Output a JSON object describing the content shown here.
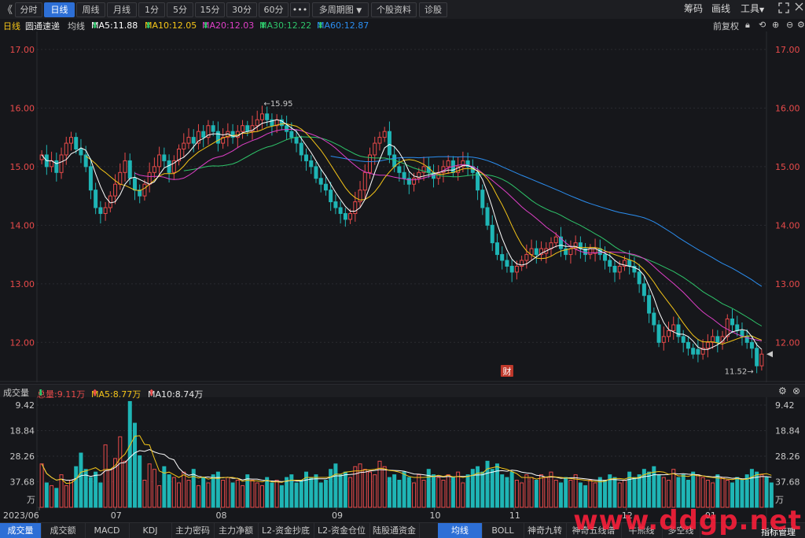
{
  "toolbar": {
    "collapse_icon": "《",
    "periods": [
      "分时",
      "日线",
      "周线",
      "月线",
      "1分",
      "5分",
      "15分",
      "30分",
      "60分"
    ],
    "active_period": "日线",
    "more_label": "•••",
    "multi_period_label": "多周期图",
    "stock_info_label": "个股资料",
    "diagnose_label": "诊股",
    "chips_label": "筹码",
    "draw_label": "画线",
    "tools_label": "工具",
    "expand_icon": "expand-icon",
    "close_icon": "close-icon"
  },
  "legend": {
    "period": "日线",
    "stock_name": "圆通速递",
    "ma_label": "均线",
    "ma5": "MA5:11.88",
    "ma10": "MA10:12.05",
    "ma20": "MA20:12.03",
    "ma30": "MA30:12.22",
    "ma60": "MA60:12.87",
    "adjust": "前复权",
    "colors": {
      "ma5": "#ffffff",
      "ma10": "#f5c518",
      "ma20": "#e040c8",
      "ma30": "#2ec46a",
      "ma60": "#2b8ef0"
    }
  },
  "volume_legend": {
    "label": "成交量",
    "total": "总量:9.11万",
    "ma5": "MA5:8.77万",
    "ma10": "MA10:8.74万"
  },
  "price_chart": {
    "y_ticks": [
      "17.00",
      "16.00",
      "15.00",
      "14.00",
      "13.00",
      "12.00"
    ],
    "high_annotation": "←15.95",
    "low_annotation": "11.52→",
    "fin_marker": "财"
  },
  "volume_chart": {
    "y_ticks": [
      "37.68",
      "28.26",
      "18.84",
      "9.42"
    ],
    "unit": "万"
  },
  "x_labels": [
    "2023/06",
    "07",
    "08",
    "09",
    "10",
    "11",
    "12",
    "01"
  ],
  "bottom_tabs": [
    "成交量",
    "成交额",
    "MACD",
    "KDJ",
    "主力密码",
    "主力净额",
    "L2-资金抄底",
    "L2-资金仓位",
    "陆股通资金",
    "均线",
    "BOLL",
    "神奇九转",
    "神奇五线谱",
    "牛熊线",
    "多空线"
  ],
  "active_left_tab": "成交量",
  "active_right_tab": "均线",
  "indicator_manage": "指标管理",
  "watermark": "www.ddgp.net",
  "chart_data": {
    "type": "candlestick",
    "title": "圆通速递 日线",
    "xlabel": "",
    "ylabel": "",
    "ylim": [
      11.4,
      17.2
    ],
    "closes": [
      15.2,
      15.0,
      15.1,
      14.9,
      15.2,
      15.4,
      15.5,
      15.3,
      15.2,
      15.0,
      14.6,
      14.3,
      14.2,
      14.3,
      14.5,
      14.7,
      14.9,
      15.1,
      14.8,
      14.6,
      14.5,
      14.7,
      14.9,
      15.0,
      15.2,
      15.1,
      14.9,
      15.1,
      15.3,
      15.4,
      15.5,
      15.4,
      15.6,
      15.5,
      15.7,
      15.6,
      15.4,
      15.5,
      15.6,
      15.5,
      15.6,
      15.7,
      15.6,
      15.7,
      15.8,
      15.9,
      15.8,
      15.7,
      15.8,
      15.7,
      15.6,
      15.5,
      15.4,
      15.2,
      15.1,
      15.0,
      14.8,
      14.7,
      14.6,
      14.4,
      14.3,
      14.2,
      14.1,
      14.2,
      14.4,
      14.6,
      14.9,
      15.2,
      15.4,
      15.5,
      15.6,
      15.2,
      15.0,
      14.9,
      14.8,
      14.7,
      14.8,
      14.9,
      15.0,
      14.9,
      14.8,
      14.9,
      15.0,
      15.1,
      14.9,
      15.0,
      15.1,
      15.0,
      14.9,
      14.6,
      14.3,
      14.0,
      13.7,
      13.5,
      13.4,
      13.3,
      13.2,
      13.3,
      13.4,
      13.5,
      13.6,
      13.5,
      13.6,
      13.6,
      13.7,
      13.8,
      13.6,
      13.5,
      13.6,
      13.7,
      13.6,
      13.5,
      13.6,
      13.6,
      13.5,
      13.4,
      13.3,
      13.2,
      13.3,
      13.4,
      13.3,
      13.2,
      13.0,
      12.8,
      12.5,
      12.3,
      12.0,
      12.1,
      12.2,
      12.3,
      12.1,
      12.0,
      11.9,
      11.8,
      11.8,
      11.9,
      12.0,
      12.1,
      12.0,
      12.1,
      12.4,
      12.3,
      12.2,
      12.1,
      12.0,
      11.9,
      11.6,
      11.8
    ],
    "volume_ylim": [
      0,
      40
    ],
    "volume_ticks": [
      9.42,
      18.84,
      28.26,
      37.68
    ],
    "volume_unit": "万",
    "volumes": [
      16,
      9,
      8,
      7,
      12,
      8,
      10,
      15,
      20,
      14,
      11,
      13,
      9,
      23,
      14,
      18,
      26,
      17,
      39,
      31,
      19,
      10,
      16,
      14,
      8,
      15,
      12,
      11,
      9,
      13,
      10,
      14,
      8,
      11,
      9,
      12,
      13,
      10,
      11,
      9,
      10,
      8,
      12,
      10,
      9,
      8,
      11,
      9,
      10,
      8,
      11,
      12,
      9,
      10,
      13,
      11,
      12,
      9,
      10,
      14,
      16,
      12,
      13,
      11,
      15,
      16,
      14,
      13,
      12,
      17,
      15,
      11,
      12,
      10,
      13,
      11,
      9,
      12,
      10,
      14,
      12,
      11,
      10,
      12,
      11,
      13,
      9,
      12,
      14,
      15,
      13,
      17,
      14,
      16,
      12,
      11,
      13,
      10,
      9,
      12,
      11,
      10,
      12,
      11,
      13,
      10,
      9,
      11,
      10,
      12,
      9,
      8,
      10,
      9,
      11,
      10,
      12,
      11,
      9,
      10,
      13,
      11,
      12,
      14,
      13,
      15,
      12,
      11,
      10,
      14,
      11,
      12,
      10,
      13,
      12,
      11,
      10,
      9,
      12,
      11,
      10,
      9,
      11,
      10,
      12,
      14,
      13,
      12,
      11,
      9
    ]
  }
}
